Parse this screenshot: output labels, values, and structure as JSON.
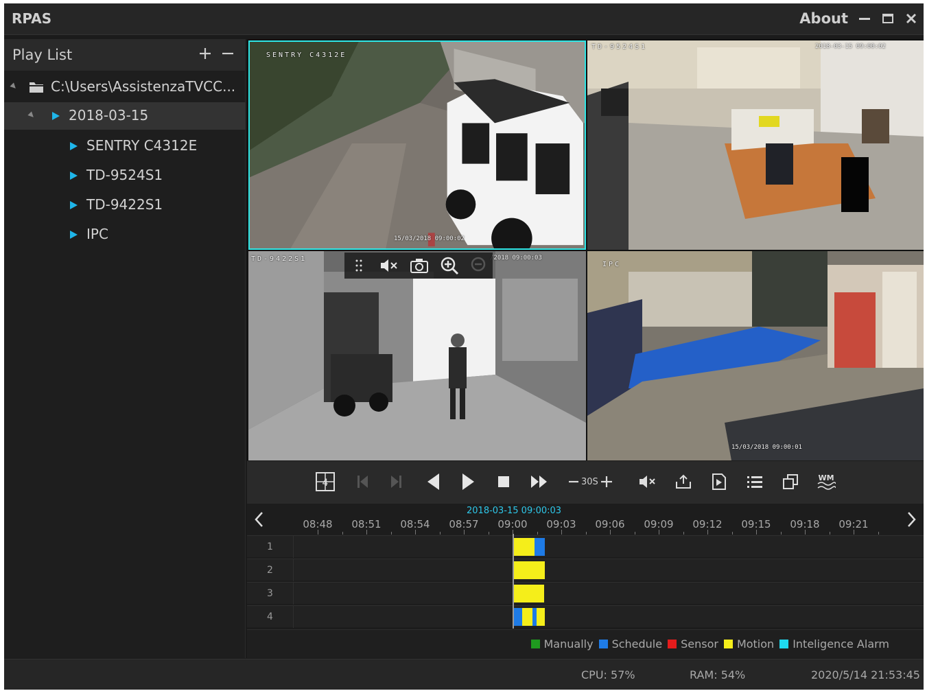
{
  "app": {
    "title": "RPAS",
    "about_label": "About"
  },
  "sidebar": {
    "header": "Play List",
    "root_path": "C:\\Users\\AssistenzaTVCC...",
    "date_node": "2018-03-15",
    "cameras": [
      "SENTRY C4312E",
      "TD-9524S1",
      "TD-9422S1",
      "IPC"
    ]
  },
  "tiles": [
    {
      "osd_name": "SENTRY C4312E",
      "osd_time": "15/03/2018 09:00:02"
    },
    {
      "osd_name": "TD-9524S1",
      "osd_time": "2018-03-15 09:00:02"
    },
    {
      "osd_name": "TD-9422S1",
      "osd_time": "/2018 09:00:03"
    },
    {
      "osd_name": "IPC",
      "osd_time": "15/03/2018 09:00:01"
    }
  ],
  "controls": {
    "speed_label": "30S"
  },
  "timeline": {
    "current_time": "2018-03-15 09:00:03",
    "ticks": [
      "08:48",
      "08:51",
      "08:54",
      "08:57",
      "09:00",
      "09:03",
      "09:06",
      "09:09",
      "09:12",
      "09:15",
      "09:18",
      "09:21"
    ],
    "tracks": [
      "1",
      "2",
      "3",
      "4"
    ]
  },
  "legend": [
    {
      "label": "Manually",
      "color": "#1f9a1f"
    },
    {
      "label": "Schedule",
      "color": "#1e7be6"
    },
    {
      "label": "Sensor",
      "color": "#e51c1c"
    },
    {
      "label": "Motion",
      "color": "#f5ee1a"
    },
    {
      "label": "Inteligence Alarm",
      "color": "#1ed9ef"
    }
  ],
  "status": {
    "cpu": "CPU: 57%",
    "ram": "RAM: 54%",
    "datetime": "2020/5/14 21:53:45"
  },
  "colors": {
    "accent": "#2ee6e6",
    "selection_blue": "#1fb6ea",
    "motion": "#f5ee1a",
    "schedule": "#1e7be6"
  }
}
